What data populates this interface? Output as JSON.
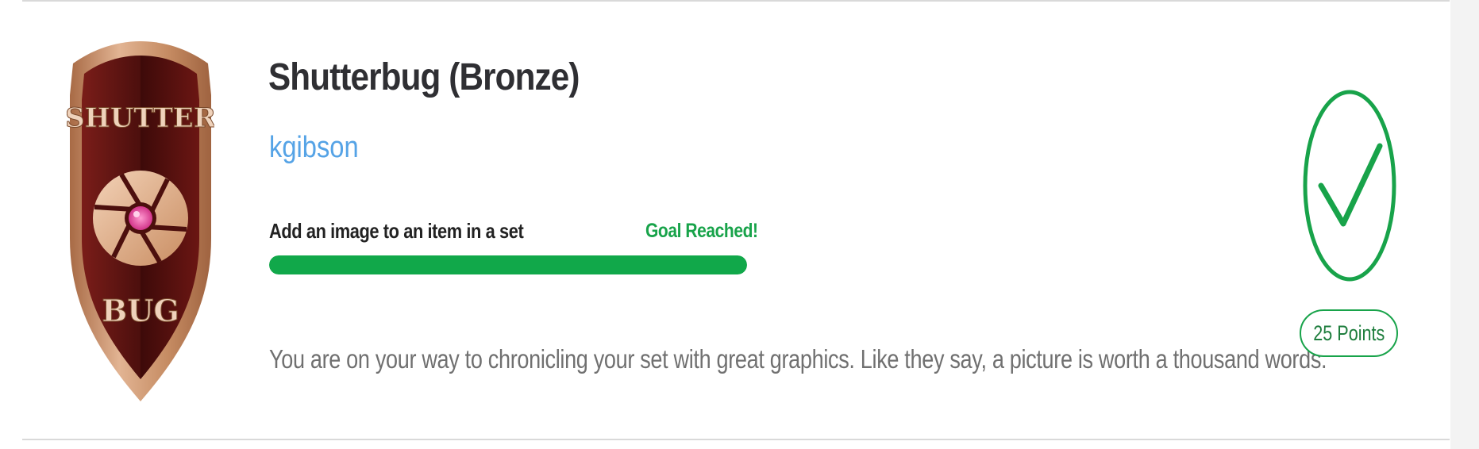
{
  "achievement": {
    "title": "Shutterbug (Bronze)",
    "username": "kgibson",
    "badge": {
      "top_text": "SHUTTER",
      "bottom_text": "BUG",
      "icon": "camera-shutter-icon",
      "colors": {
        "rim": "#c48a63",
        "shield": "#5a1210",
        "lens": "#e85aa8"
      }
    },
    "goal": {
      "label": "Add an image to an item in a set",
      "status": "Goal Reached!",
      "progress_percent": 100
    },
    "description": "You are on your way to chronicling your set with great graphics. Like they say, a picture is worth a thousand words.",
    "completed_icon": "checkmark-circle-icon",
    "points_label": "25 Points"
  },
  "colors": {
    "title": "#2f2f33",
    "username": "#55a3e6",
    "success": "#18a34a",
    "progress_fill": "#11a84a",
    "description": "#707070",
    "divider": "#d9d9d9"
  }
}
